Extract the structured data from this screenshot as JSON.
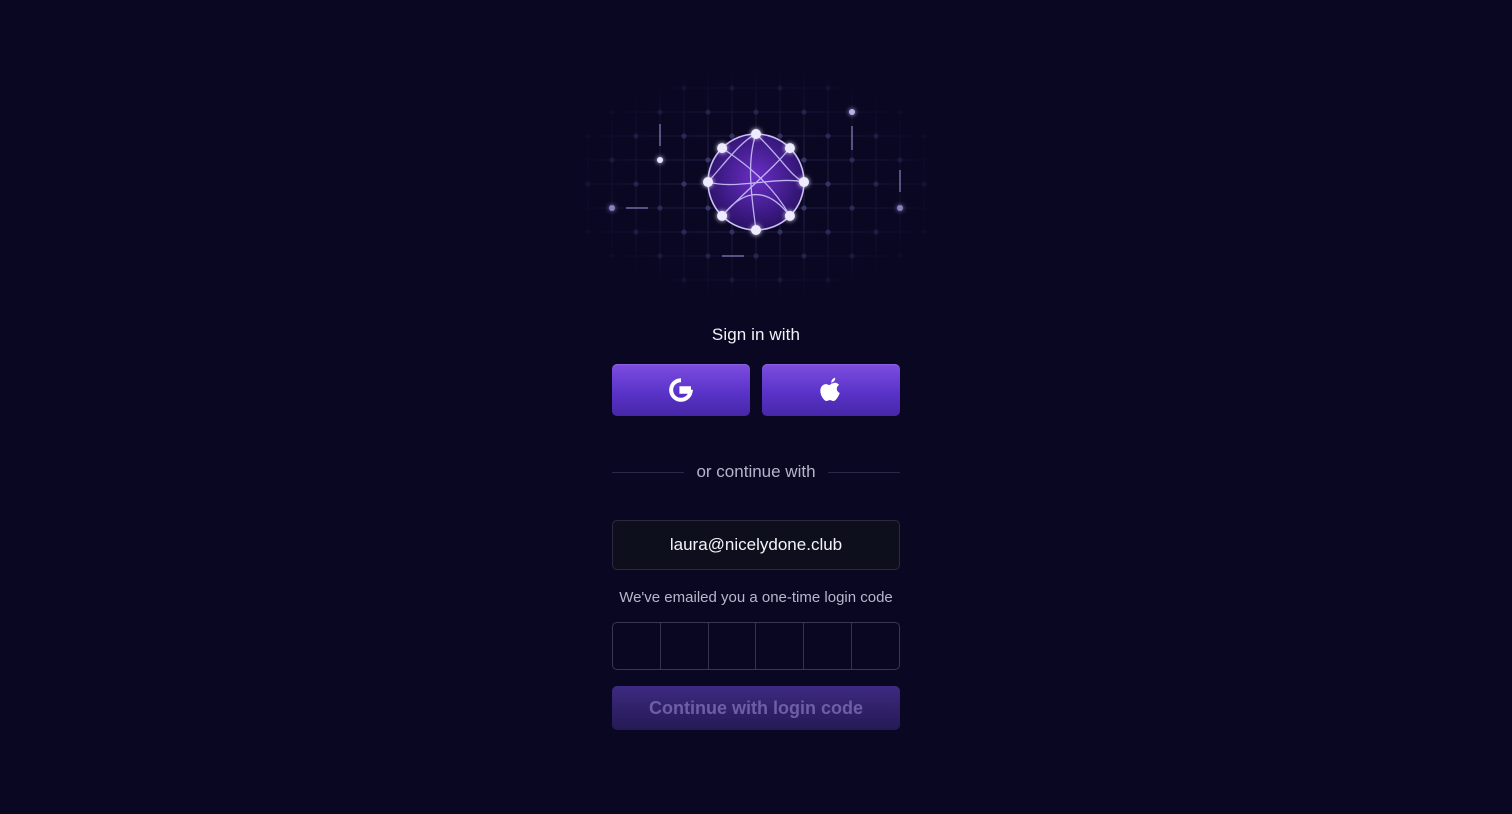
{
  "auth": {
    "heading": "Sign in with",
    "providers": [
      {
        "name": "Google",
        "icon": "google-icon"
      },
      {
        "name": "Apple",
        "icon": "apple-icon"
      }
    ],
    "divider_text": "or continue with",
    "email_value": "laura@nicelydone.club",
    "code_notice": "We've emailed you a one-time login code",
    "code_length": 6,
    "submit_label": "Continue with login code"
  },
  "colors": {
    "background": "#0a0722",
    "accent": "#6b3fd9",
    "accent_disabled": "#2f2068"
  }
}
